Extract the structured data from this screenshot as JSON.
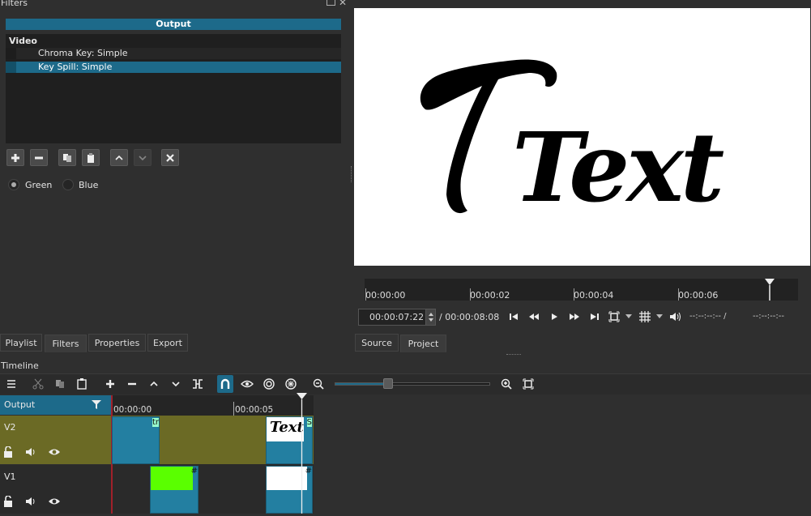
{
  "filters": {
    "dock_title": "Filters",
    "header": "Output",
    "group_label": "Video",
    "items": [
      {
        "label": "Chroma Key: Simple"
      },
      {
        "label": "Key Spill: Simple"
      }
    ],
    "options": [
      {
        "label": "Green",
        "checked": true
      },
      {
        "label": "Blue",
        "checked": false
      }
    ]
  },
  "viewer": {
    "preview_text": "Text",
    "ruler": [
      "00:00:00",
      "00:00:02",
      "00:00:04",
      "00:00:06"
    ],
    "current_time": "00:00:07:22",
    "total_time": "/ 00:00:08:08",
    "in_point": "--:--:--:-- /",
    "out_point": "--:--:--:--"
  },
  "left_tabs": [
    "Playlist",
    "Filters",
    "Properties",
    "Export"
  ],
  "viewer_tabs": [
    "Source",
    "Project"
  ],
  "timeline": {
    "title": "Timeline",
    "output_label": "Output",
    "ruler": [
      "00:00:00",
      "00:00:05"
    ],
    "tracks": [
      {
        "name": "V2"
      },
      {
        "name": "V1"
      }
    ],
    "clip_labels": [
      "tr",
      "S",
      "#",
      "#"
    ],
    "clip_thumb_text": "Text"
  },
  "colors": {
    "accent": "#1d6a8a",
    "track_v2": "#6b6a25",
    "clip_blue": "#237fa1",
    "green_clip": "#5aff00"
  }
}
